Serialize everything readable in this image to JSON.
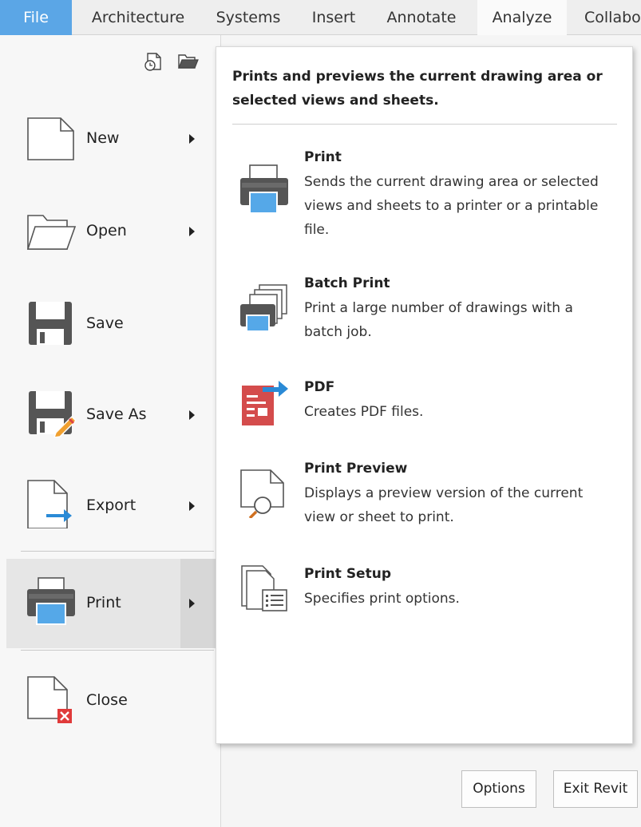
{
  "ribbon": {
    "tabs": [
      {
        "label": "File"
      },
      {
        "label": "Architecture"
      },
      {
        "label": "Systems"
      },
      {
        "label": "Insert"
      },
      {
        "label": "Annotate"
      },
      {
        "label": "Analyze"
      },
      {
        "label": "Collabo"
      }
    ]
  },
  "menu": {
    "quick_icons": [
      "recent-documents-icon",
      "open-documents-icon"
    ],
    "items": [
      {
        "label": "New",
        "icon": "new-document-icon",
        "has_submenu": true
      },
      {
        "label": "Open",
        "icon": "open-folder-icon",
        "has_submenu": true
      },
      {
        "label": "Save",
        "icon": "floppy-disk-icon",
        "has_submenu": false
      },
      {
        "label": "Save As",
        "icon": "save-as-icon",
        "has_submenu": true
      },
      {
        "label": "Export",
        "icon": "export-icon",
        "has_submenu": true
      },
      {
        "label": "Print",
        "icon": "printer-icon",
        "has_submenu": true,
        "active": true
      },
      {
        "label": "Close",
        "icon": "close-document-icon",
        "has_submenu": false
      }
    ]
  },
  "submenu": {
    "description": "Prints and previews the current drawing area or selected views and sheets.",
    "items": [
      {
        "title": "Print",
        "description": "Sends the current drawing area or selected views and sheets to a printer or a printable file.",
        "icon": "printer-icon"
      },
      {
        "title": "Batch Print",
        "description": "Print a large number of drawings with a batch job.",
        "icon": "batch-print-icon"
      },
      {
        "title": "PDF",
        "description": "Creates PDF files.",
        "icon": "pdf-icon"
      },
      {
        "title": "Print Preview",
        "description": "Displays a preview version of the current view or sheet to print.",
        "icon": "print-preview-icon"
      },
      {
        "title": "Print Setup",
        "description": "Specifies print options.",
        "icon": "print-setup-icon"
      }
    ]
  },
  "footer": {
    "options_label": "Options",
    "exit_label": "Exit Revit"
  },
  "colors": {
    "accent": "#5ba6e6",
    "printer_screen": "#55a8e8",
    "pdf_red": "#d44c4c",
    "close_red": "#e03a3a",
    "export_arrow": "#2a8ad6"
  }
}
